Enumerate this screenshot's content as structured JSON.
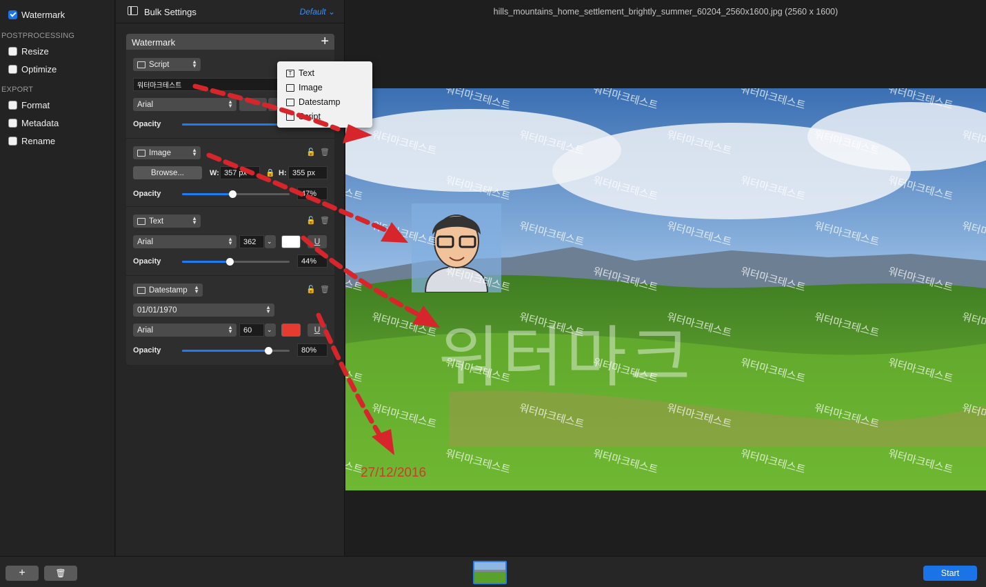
{
  "sidebar": {
    "items": [
      {
        "label": "Watermark",
        "checked": true
      },
      {
        "label": "Resize",
        "checked": false
      },
      {
        "label": "Optimize",
        "checked": false
      },
      {
        "label": "Format",
        "checked": false
      },
      {
        "label": "Metadata",
        "checked": false
      },
      {
        "label": "Rename",
        "checked": false
      }
    ],
    "sections": [
      "POSTPROCESSING",
      "EXPORT"
    ]
  },
  "settings": {
    "title": "Bulk Settings",
    "preset": "Default",
    "panel_title": "Watermark",
    "add_symbol": "+",
    "script": {
      "type_label": "Script",
      "text_value": "워터마크테스트",
      "font": "Arial",
      "opacity_label": "Opacity"
    },
    "image": {
      "type_label": "Image",
      "browse_label": "Browse...",
      "w_label": "W:",
      "w_value": "357 px",
      "h_label": "H:",
      "h_value": "355 px",
      "opacity_label": "Opacity",
      "opacity_value": "47%",
      "opacity_fraction": 0.47
    },
    "text": {
      "type_label": "Text",
      "font": "Arial",
      "size": "362",
      "underline": "U",
      "opacity_label": "Opacity",
      "opacity_value": "44%",
      "opacity_fraction": 0.44,
      "color": "#ffffff"
    },
    "datestamp": {
      "type_label": "Datestamp",
      "date_format": "01/01/1970",
      "font": "Arial",
      "size": "60",
      "underline": "U",
      "opacity_label": "Opacity",
      "opacity_value": "80%",
      "opacity_fraction": 0.8,
      "color": "#e53b30"
    }
  },
  "add_menu": {
    "items": [
      "Text",
      "Image",
      "Datestamp",
      "Script"
    ]
  },
  "preview": {
    "file_title": "hills_mountains_home_settlement_brightly_summer_60204_2560x1600.jpg (2560 x 1600)",
    "script_watermark": "워터마크테스트",
    "text_watermark": "워터마크",
    "date_watermark": "27/12/2016"
  },
  "bottombar": {
    "add_symbol": "+",
    "trash_symbol": "🗑",
    "start_label": "Start"
  },
  "colors": {
    "accent": "#1a74e8",
    "arrow": "#d6262c"
  }
}
